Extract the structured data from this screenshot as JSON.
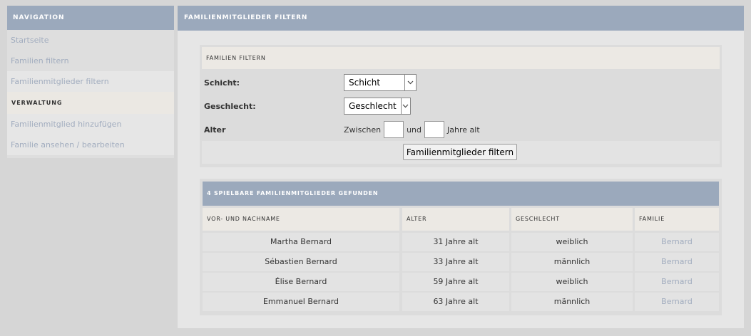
{
  "sidebar": {
    "title": "NAVIGATION",
    "items": [
      {
        "label": "Startseite"
      },
      {
        "label": "Familien filtern"
      },
      {
        "label": "Familienmitglieder filtern"
      }
    ],
    "section_title": "VERWALTUNG",
    "admin_items": [
      {
        "label": "Familienmitglied hinzufügen"
      },
      {
        "label": "Familie ansehen / bearbeiten"
      }
    ]
  },
  "main": {
    "title": "FAMILIENMITGLIEDER FILTERN",
    "filter": {
      "title": "FAMILIEN FILTERN",
      "schicht_label": "Schicht:",
      "schicht_value": "Schicht",
      "geschlecht_label": "Geschlecht:",
      "geschlecht_value": "Geschlecht",
      "alter_label": "Alter",
      "zwischen": "Zwischen",
      "und": "und",
      "jahre_alt": "Jahre alt",
      "submit_label": "Familienmitglieder filtern"
    },
    "results": {
      "title": "4 SPIELBARE FAMILIENMITGLIEDER GEFUNDEN",
      "columns": [
        "VOR- UND NACHNAME",
        "ALTER",
        "GESCHLECHT",
        "FAMILIE"
      ],
      "rows": [
        {
          "name": "Martha Bernard",
          "alter": "31 Jahre alt",
          "geschlecht": "weiblich",
          "familie": "Bernard"
        },
        {
          "name": "Sébastien Bernard",
          "alter": "33 Jahre alt",
          "geschlecht": "männlich",
          "familie": "Bernard"
        },
        {
          "name": "Élise Bernard",
          "alter": "59 Jahre alt",
          "geschlecht": "weiblich",
          "familie": "Bernard"
        },
        {
          "name": "Emmanuel Bernard",
          "alter": "63 Jahre alt",
          "geschlecht": "männlich",
          "familie": "Bernard"
        }
      ]
    }
  },
  "icons": {
    "dropdown": "chevron-down-icon"
  },
  "colors": {
    "header": "#9ba9bc",
    "link": "#a2adbf",
    "subheader": "#ece9e4"
  }
}
